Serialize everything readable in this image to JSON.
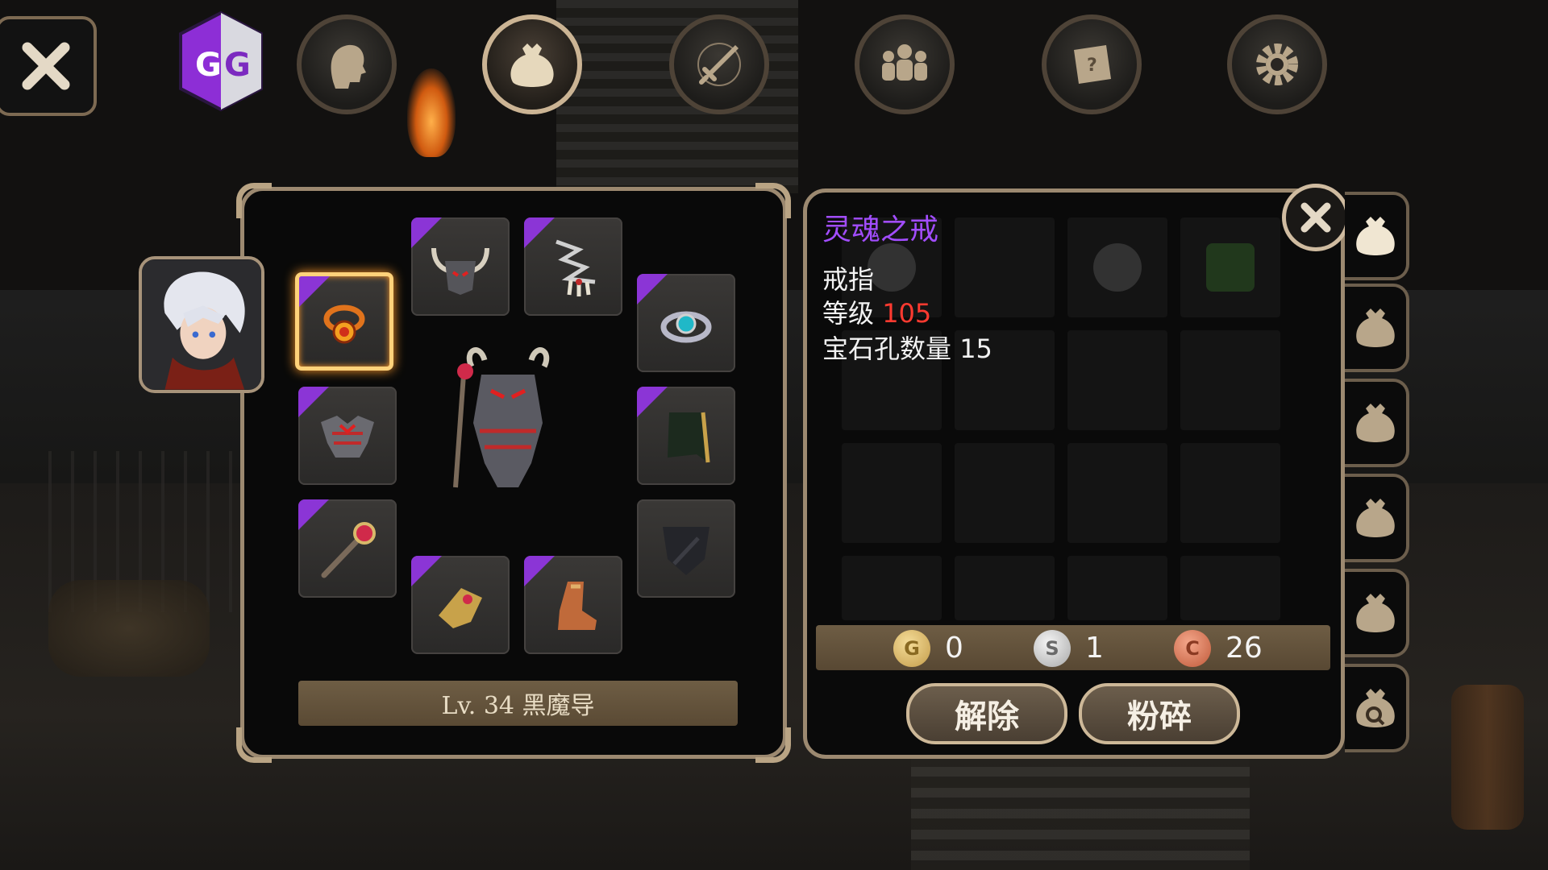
{
  "top_bar": {
    "logo_text": "GG",
    "tabs": [
      {
        "icon": "head-icon",
        "active": false
      },
      {
        "icon": "bag-icon",
        "active": true
      },
      {
        "icon": "sword-icon",
        "active": false
      },
      {
        "icon": "party-icon",
        "active": false
      },
      {
        "icon": "quest-scroll-icon",
        "active": false
      },
      {
        "icon": "gear-icon",
        "active": false
      }
    ]
  },
  "character": {
    "level_label": "Lv. 34 黑魔导",
    "slots": [
      {
        "icon": "ring-icon",
        "rarity_color": "#8b35d6",
        "selected": true
      },
      {
        "icon": "horned-helmet-icon",
        "rarity_color": "#8b35d6"
      },
      {
        "icon": "fang-necklace-icon",
        "rarity_color": "#8b35d6"
      },
      {
        "icon": "gem-ring-icon",
        "rarity_color": "#8b35d6"
      },
      {
        "icon": "armor-icon",
        "rarity_color": "#8b35d6"
      },
      {
        "icon": "cape-icon",
        "rarity_color": "#8b35d6"
      },
      {
        "icon": "staff-icon",
        "rarity_color": "#8b35d6"
      },
      {
        "icon": "shield-empty-icon"
      },
      {
        "icon": "gauntlet-icon",
        "rarity_color": "#8b35d6"
      },
      {
        "icon": "boots-icon",
        "rarity_color": "#8b35d6"
      }
    ]
  },
  "item_info": {
    "name": "灵魂之戒",
    "name_color": "#a24dff",
    "type": "戒指",
    "level_label": "等级",
    "level_value": "105",
    "gem_label": "宝石孔数量",
    "gem_value": "15"
  },
  "currency": {
    "gold_symbol": "G",
    "gold": "0",
    "silver_symbol": "S",
    "silver": "1",
    "copper_symbol": "C",
    "copper": "26"
  },
  "actions": {
    "unequip": "解除",
    "smash": "粉碎"
  },
  "side_tabs": [
    "bag-icon",
    "bag-icon",
    "bag-icon",
    "bag-icon",
    "bag-icon",
    "bag-search-icon"
  ]
}
